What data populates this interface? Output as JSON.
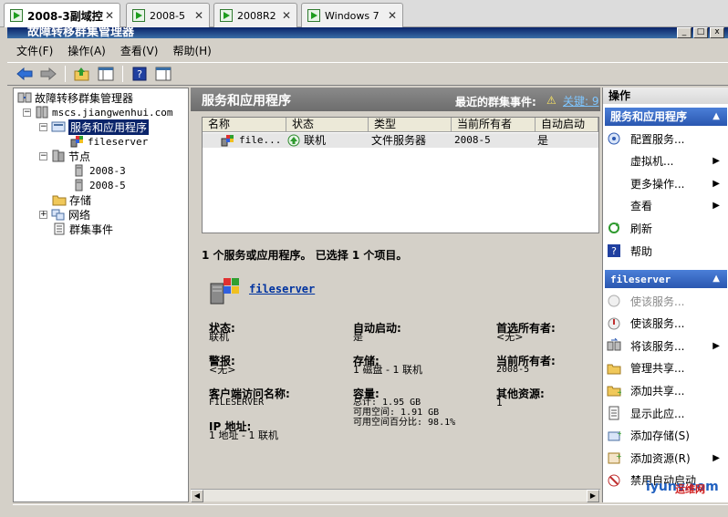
{
  "tabs": [
    {
      "label": "2008-3副域控",
      "active": true
    },
    {
      "label": "2008-5",
      "active": false
    },
    {
      "label": "2008R2",
      "active": false
    },
    {
      "label": "Windows 7",
      "active": false
    }
  ],
  "window": {
    "title": "故障转移群集管理器"
  },
  "menu": [
    "文件(F)",
    "操作(A)",
    "查看(V)",
    "帮助(H)"
  ],
  "tree": {
    "root": "故障转移群集管理器",
    "cluster": "mscs.jiangwenhui.com",
    "services": "服务和应用程序",
    "fileserver": "fileserver",
    "nodes": "节点",
    "node1": "2008-3",
    "node2": "2008-5",
    "storage": "存储",
    "network": "网络",
    "events": "群集事件"
  },
  "center": {
    "title": "服务和应用程序",
    "recent_events_label": "最近的群集事件:",
    "recent_events_link": "关键: 9",
    "columns": [
      "名称",
      "状态",
      "类型",
      "当前所有者",
      "自动启动"
    ],
    "row": {
      "name": "file...",
      "status": "联机",
      "type": "文件服务器",
      "owner": "2008-5",
      "autostart": "是"
    },
    "summary": "1 个服务或应用程序。  已选择 1 个项目。",
    "detail_title": "fileserver",
    "details": {
      "status_label": "状态:",
      "status_value": "联机",
      "autostart_label": "自动启动:",
      "autostart_value": "是",
      "preferred_label": "首选所有者:",
      "preferred_value": "<无>",
      "alerts_label": "警报:",
      "alerts_value": "<无>",
      "storage_label": "存储:",
      "storage_value": "1 磁盘 - 1 联机",
      "owner_label": "当前所有者:",
      "owner_value": "2008-5",
      "access_label": "客户端访问名称:",
      "access_value": "FILESERVER",
      "capacity_label": "容量:",
      "capacity_total": "总计: 1.95 GB",
      "capacity_free": "可用空间: 1.91 GB",
      "capacity_pct": "可用空间百分比: 98.1%",
      "other_label": "其他资源:",
      "other_value": "1",
      "ip_label": "IP 地址:",
      "ip_value": "1 地址 - 1 联机"
    }
  },
  "actions": {
    "header": "操作",
    "section1": "服务和应用程序",
    "items1": [
      {
        "label": "配置服务...",
        "icon": "configure-icon",
        "arrow": false,
        "disabled": false
      },
      {
        "label": "虚拟机...",
        "icon": "",
        "arrow": true,
        "disabled": false
      },
      {
        "label": "更多操作...",
        "icon": "",
        "arrow": true,
        "disabled": false
      },
      {
        "label": "查看",
        "icon": "",
        "arrow": true,
        "disabled": false
      },
      {
        "label": "刷新",
        "icon": "refresh-icon",
        "arrow": false,
        "disabled": false
      },
      {
        "label": "帮助",
        "icon": "help-icon",
        "arrow": false,
        "disabled": false
      }
    ],
    "section2": "fileserver",
    "items2": [
      {
        "label": "使该服务...",
        "icon": "online-icon",
        "arrow": false,
        "disabled": true
      },
      {
        "label": "使该服务...",
        "icon": "offline-icon",
        "arrow": false,
        "disabled": false
      },
      {
        "label": "将该服务...",
        "icon": "move-icon",
        "arrow": true,
        "disabled": false
      },
      {
        "label": "管理共享...",
        "icon": "share-icon",
        "arrow": false,
        "disabled": false
      },
      {
        "label": "添加共享...",
        "icon": "add-share-icon",
        "arrow": false,
        "disabled": false
      },
      {
        "label": "显示此应...",
        "icon": "report-icon",
        "arrow": false,
        "disabled": false
      },
      {
        "label": "添加存储(S)",
        "icon": "storage-icon",
        "arrow": false,
        "disabled": false
      },
      {
        "label": "添加资源(R)",
        "icon": "resource-icon",
        "arrow": true,
        "disabled": false
      },
      {
        "label": "禁用自动启动",
        "icon": "disable-icon",
        "arrow": false,
        "disabled": false
      }
    ]
  },
  "watermark": "iyunv.com",
  "watermark_cn": "运维网",
  "colors": {
    "selection": "#0a246a",
    "section": "#2a57b0",
    "header": "#6d6d6d"
  }
}
